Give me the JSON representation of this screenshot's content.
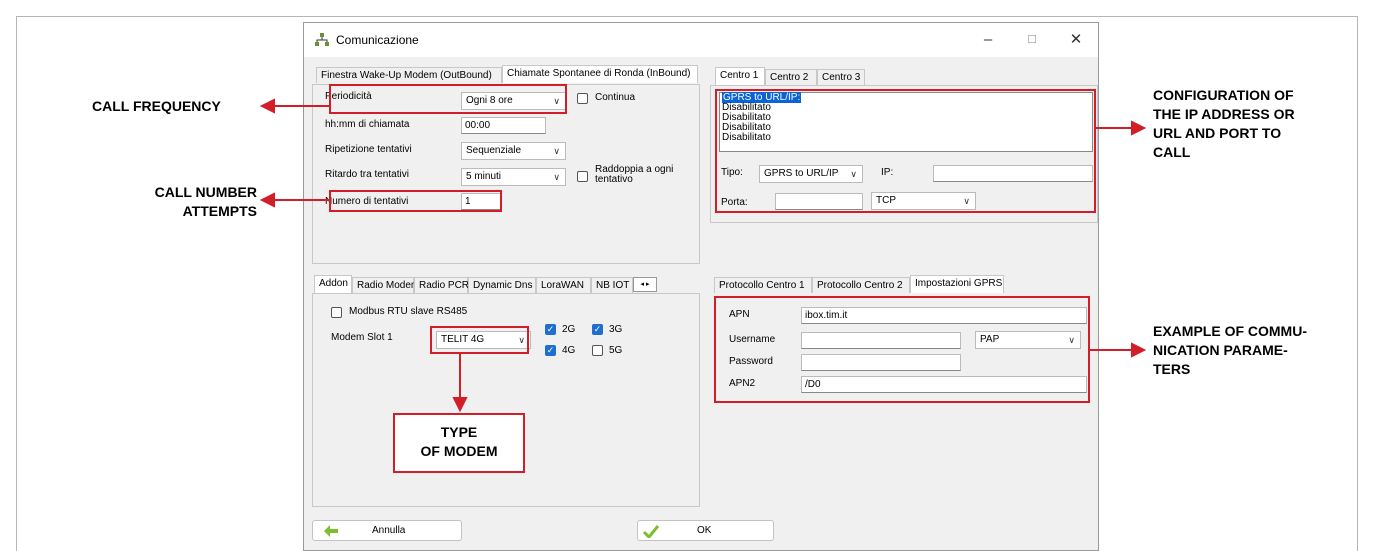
{
  "window": {
    "title": "Comunicazione",
    "minimize": "–",
    "maximize": "☐",
    "close": "✕"
  },
  "top_left": {
    "tabs": [
      "Finestra Wake-Up Modem (OutBound)",
      "Chiamate Spontanee di Ronda (InBound)"
    ],
    "periodicita_label": "Periodicità",
    "periodicita_value": "Ogni 8 ore",
    "continua_label": "Continua",
    "hhmm_label": "hh:mm di chiamata",
    "hhmm_value": "00:00",
    "ripetizione_label": "Ripetizione tentativi",
    "ripetizione_value": "Sequenziale",
    "ritardo_label": "Ritardo tra tentativi",
    "ritardo_value": "5 minuti",
    "raddoppia_label": "Raddoppia a ogni tentativo",
    "numero_label": "Numero di tentativi",
    "numero_value": "1"
  },
  "top_right": {
    "tabs": [
      "Centro 1",
      "Centro 2",
      "Centro 3"
    ],
    "list_items": [
      "GPRS to URL/IP:",
      "Disabilitato",
      "Disabilitato",
      "Disabilitato",
      "Disabilitato"
    ],
    "tipo_label": "Tipo:",
    "tipo_value": "GPRS to URL/IP",
    "ip_label": "IP:",
    "ip_value": "",
    "porta_label": "Porta:",
    "porta_value": "",
    "protocol_value": "TCP"
  },
  "bottom_left": {
    "tabs": [
      "Addon",
      "Radio Modem",
      "Radio PCR",
      "Dynamic Dns",
      "LoraWAN",
      "NB IOT /"
    ],
    "modbus_label": "Modbus RTU slave RS485",
    "modem_slot_label": "Modem Slot 1",
    "modem_value": "TELIT 4G",
    "bands": [
      {
        "label": "2G",
        "checked": true
      },
      {
        "label": "3G",
        "checked": true
      },
      {
        "label": "4G",
        "checked": true
      },
      {
        "label": "5G",
        "checked": false
      }
    ]
  },
  "bottom_right": {
    "tabs": [
      "Protocollo Centro 1",
      "Protocollo Centro 2",
      "Impostazioni GPRS"
    ],
    "apn_label": "APN",
    "apn_value": "ibox.tim.it",
    "username_label": "Username",
    "username_value": "",
    "auth_value": "PAP",
    "password_label": "Password",
    "password_value": "",
    "apn2_label": "APN2",
    "apn2_value": "/D0"
  },
  "buttons": {
    "cancel": "Annulla",
    "ok": "OK"
  },
  "annotations": {
    "call_frequency": "CALL FREQUENCY",
    "call_attempts_1": "CALL NUMBER",
    "call_attempts_2": "ATTEMPTS",
    "ip_config_1": "CONFIGURATION OF",
    "ip_config_2": "THE IP ADDRESS OR",
    "ip_config_3": "URL AND PORT TO",
    "ip_config_4": "CALL",
    "comm_params_1": "EXAMPLE OF COMMU-",
    "comm_params_2": "NICATION PARAME-",
    "comm_params_3": "TERS",
    "modem_type_1": "TYPE",
    "modem_type_2": "OF MODEM"
  },
  "colors": {
    "annotation_red": "#d11f2a",
    "check_blue": "#1f6fd1",
    "list_selected": "#0a64d8"
  }
}
